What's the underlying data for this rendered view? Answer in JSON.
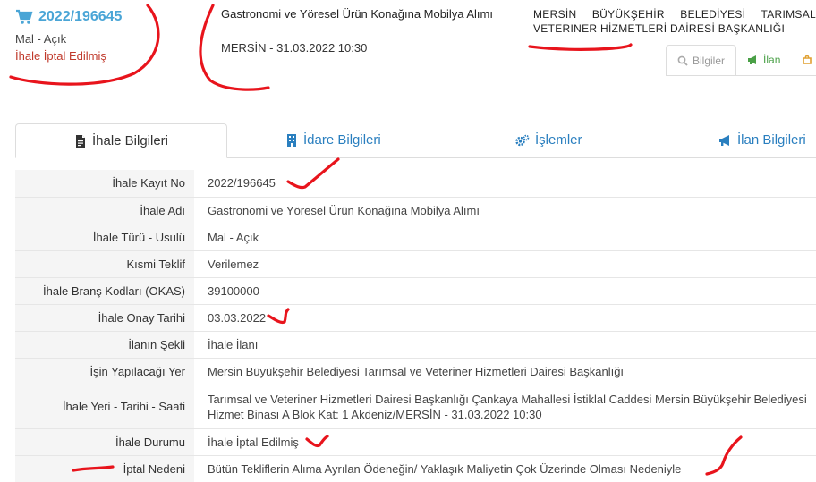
{
  "header": {
    "ikn": "2022/196645",
    "type": "Mal - Açık",
    "status": "İhale İptal Edilmiş",
    "title": "Gastronomi ve Yöresel Ürün Konağına Mobilya Alımı",
    "place_date": "MERSİN - 31.03.2022 10:30",
    "agency": "MERSİN BÜYÜKŞEHİR BELEDİYESİ TARIMSAL VETERINER HİZMETLERİ DAİRESİ BAŞKANLIĞI",
    "mini_tabs": [
      {
        "label": "Bilgiler",
        "icon": "search-icon"
      },
      {
        "label": "İlan",
        "icon": "megaphone-icon"
      },
      {
        "label": "",
        "icon": "puzzle-icon"
      }
    ]
  },
  "tabs": [
    {
      "label": "İhale Bilgileri",
      "icon": "document-icon",
      "active": true
    },
    {
      "label": "İdare Bilgileri",
      "icon": "building-icon"
    },
    {
      "label": "İşlemler",
      "icon": "gears-icon"
    },
    {
      "label": "İlan Bilgileri",
      "icon": "megaphone-icon"
    }
  ],
  "details": [
    {
      "label": "İhale Kayıt No",
      "value": "2022/196645"
    },
    {
      "label": "İhale Adı",
      "value": "Gastronomi ve Yöresel Ürün Konağına Mobilya Alımı"
    },
    {
      "label": "İhale Türü - Usulü",
      "value": "Mal - Açık"
    },
    {
      "label": "Kısmi Teklif",
      "value": "Verilemez"
    },
    {
      "label": "İhale Branş Kodları (OKAS)",
      "value": "39100000"
    },
    {
      "label": "İhale Onay Tarihi",
      "value": "03.03.2022"
    },
    {
      "label": "İlanın Şekli",
      "value": "İhale İlanı"
    },
    {
      "label": "İşin Yapılacağı Yer",
      "value": "Mersin Büyükşehir Belediyesi Tarımsal ve Veteriner Hizmetleri Dairesi Başkanlığı"
    },
    {
      "label": "İhale Yeri - Tarihi - Saati",
      "value": "Tarımsal ve Veteriner Hizmetleri Dairesi Başkanlığı Çankaya Mahallesi İstiklal Caddesi Mersin Büyükşehir Belediyesi Hizmet Binası A Blok Kat: 1 Akdeniz/MERSİN - 31.03.2022 10:30"
    },
    {
      "label": "İhale Durumu",
      "value": "İhale İptal Edilmiş"
    },
    {
      "label": "İptal Nedeni",
      "value": "Bütün Tekliflerin Alıma Ayrılan Ödeneğin/ Yaklaşık Maliyetin Çok Üzerinde Olması Nedeniyle"
    }
  ],
  "colors": {
    "link": "#2a7fbf",
    "ikn": "#4aa5d6",
    "status": "#c0392b",
    "annotation": "#e8141c"
  }
}
